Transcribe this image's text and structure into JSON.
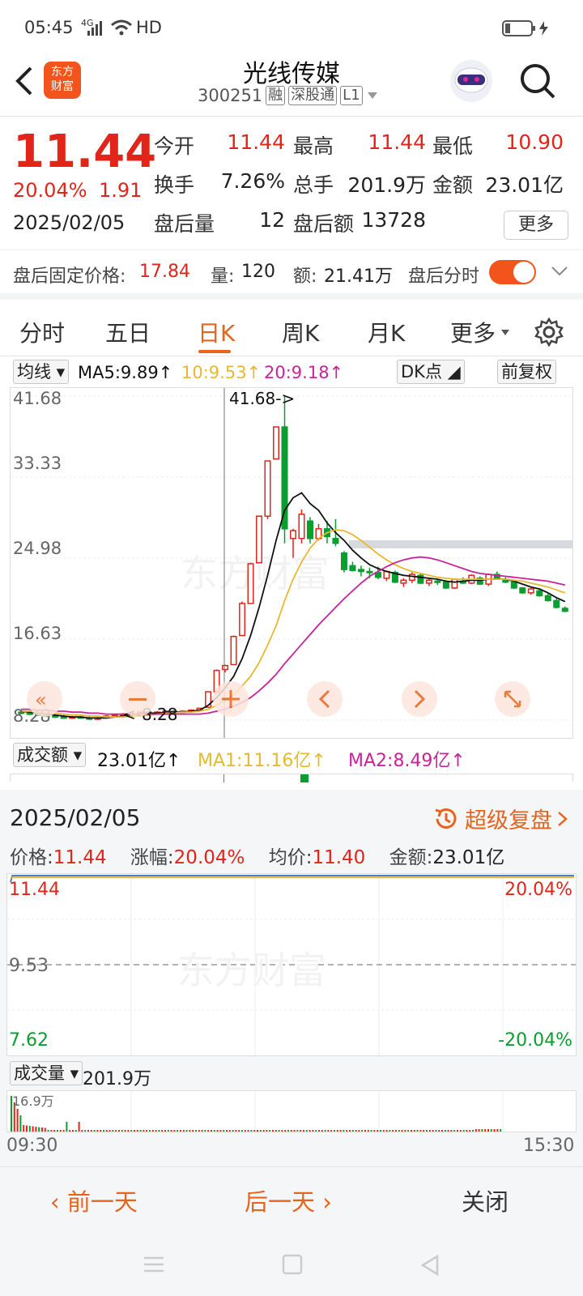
{
  "status": {
    "time": "05:45",
    "network": "4G",
    "hd": "HD"
  },
  "header": {
    "title": "光线传媒",
    "code": "300251",
    "tags": [
      "融",
      "深股通",
      "L1"
    ]
  },
  "quote": {
    "price": "11.44",
    "pct": "20.04%",
    "change": "1.91",
    "date": "2025/02/05",
    "rows": [
      [
        {
          "label": "今开",
          "value": "11.44"
        },
        {
          "label": "最高",
          "value": "11.44"
        },
        {
          "label": "最低",
          "value": "10.90"
        }
      ],
      [
        {
          "label": "换手",
          "value": "7.26%"
        },
        {
          "label": "总手",
          "value": "201.9万"
        },
        {
          "label": "金额",
          "value": "23.01亿"
        }
      ],
      [
        {
          "label": "盘后量",
          "value": "12"
        },
        {
          "label": "盘后额",
          "value": "13728"
        }
      ]
    ],
    "more": "更多"
  },
  "after_hours": {
    "fixed_label": "盘后固定价格:",
    "fixed_price": "17.84",
    "vol_label": "量:",
    "vol": "120",
    "amt_label": "额:",
    "amt": "21.41万",
    "toggle_label": "盘后分时",
    "toggle_on": true
  },
  "tabs": [
    {
      "label": "分时"
    },
    {
      "label": "五日"
    },
    {
      "label": "日K",
      "active": true
    },
    {
      "label": "周K"
    },
    {
      "label": "月K"
    },
    {
      "label": "更多"
    }
  ],
  "ma": {
    "selector": "均线",
    "ma5": "MA5:9.89↑",
    "ma10": "10:9.53↑",
    "ma20": "20:9.18↑",
    "dk": "DK点",
    "adjust": "前复权"
  },
  "colors": {
    "up": "#e1251b",
    "down": "#0a9d2f",
    "accent": "#e8641c",
    "ma5": "#111111",
    "ma10": "#e8b830",
    "ma20": "#cc2299"
  },
  "kline_axis": {
    "y_labels": [
      "41.68",
      "33.33",
      "24.98",
      "16.63",
      "8.28"
    ],
    "max_marker": "41.68->",
    "min_marker": "<-8.28"
  },
  "chart_data": [
    {
      "type": "candlestick",
      "ylim": [
        8.28,
        41.68
      ],
      "series": [
        {
          "open": 9.1,
          "high": 9.3,
          "low": 8.9,
          "close": 9.0
        },
        {
          "open": 9.0,
          "high": 9.2,
          "low": 8.8,
          "close": 8.9
        },
        {
          "open": 8.9,
          "high": 9.1,
          "low": 8.7,
          "close": 8.8
        },
        {
          "open": 8.8,
          "high": 9.0,
          "low": 8.6,
          "close": 8.7
        },
        {
          "open": 8.7,
          "high": 8.9,
          "low": 8.5,
          "close": 8.6
        },
        {
          "open": 8.6,
          "high": 8.8,
          "low": 8.4,
          "close": 8.5
        },
        {
          "open": 8.5,
          "high": 8.7,
          "low": 8.4,
          "close": 8.6
        },
        {
          "open": 8.6,
          "high": 8.8,
          "low": 8.5,
          "close": 8.5
        },
        {
          "open": 8.5,
          "high": 8.7,
          "low": 8.3,
          "close": 8.4
        },
        {
          "open": 8.4,
          "high": 8.6,
          "low": 8.28,
          "close": 8.5
        },
        {
          "open": 8.5,
          "high": 8.8,
          "low": 8.4,
          "close": 8.7
        },
        {
          "open": 8.7,
          "high": 8.9,
          "low": 8.6,
          "close": 8.8
        },
        {
          "open": 8.8,
          "high": 9.0,
          "low": 8.7,
          "close": 8.9
        },
        {
          "open": 8.9,
          "high": 9.1,
          "low": 8.8,
          "close": 9.0
        },
        {
          "open": 9.0,
          "high": 9.2,
          "low": 8.9,
          "close": 9.1
        },
        {
          "open": 9.1,
          "high": 9.3,
          "low": 9.0,
          "close": 9.0
        },
        {
          "open": 9.0,
          "high": 9.2,
          "low": 8.9,
          "close": 9.1
        },
        {
          "open": 9.1,
          "high": 9.3,
          "low": 9.0,
          "close": 9.2
        },
        {
          "open": 9.2,
          "high": 9.3,
          "low": 9.0,
          "close": 9.1
        },
        {
          "open": 9.1,
          "high": 9.3,
          "low": 9.0,
          "close": 9.2
        },
        {
          "open": 9.2,
          "high": 9.4,
          "low": 9.1,
          "close": 9.3
        },
        {
          "open": 9.3,
          "high": 9.5,
          "low": 9.2,
          "close": 9.5
        },
        {
          "open": 9.6,
          "high": 11.2,
          "low": 9.6,
          "close": 11.2
        },
        {
          "open": 11.2,
          "high": 13.5,
          "low": 11.2,
          "close": 13.4
        },
        {
          "open": 13.5,
          "high": 14.0,
          "low": 13.2,
          "close": 13.9
        },
        {
          "open": 14.0,
          "high": 17.0,
          "low": 14.0,
          "close": 16.9
        },
        {
          "open": 17.0,
          "high": 20.5,
          "low": 17.0,
          "close": 20.3
        },
        {
          "open": 20.3,
          "high": 24.5,
          "low": 20.3,
          "close": 24.4
        },
        {
          "open": 24.5,
          "high": 29.3,
          "low": 24.5,
          "close": 29.3
        },
        {
          "open": 29.3,
          "high": 35.0,
          "low": 29.0,
          "close": 35.0
        },
        {
          "open": 35.2,
          "high": 38.5,
          "low": 35.2,
          "close": 38.5
        },
        {
          "open": 38.5,
          "high": 41.68,
          "low": 26.5,
          "close": 28.0
        },
        {
          "open": 27.0,
          "high": 28.0,
          "low": 25.0,
          "close": 27.8
        },
        {
          "open": 27.0,
          "high": 30.0,
          "low": 26.5,
          "close": 29.5
        },
        {
          "open": 28.8,
          "high": 29.2,
          "low": 26.5,
          "close": 27.0
        },
        {
          "open": 27.0,
          "high": 28.5,
          "low": 26.8,
          "close": 28.0
        },
        {
          "open": 28.0,
          "high": 28.8,
          "low": 26.5,
          "close": 27.2
        },
        {
          "open": 27.0,
          "high": 29.0,
          "low": 26.2,
          "close": 26.5
        },
        {
          "open": 25.5,
          "high": 25.7,
          "low": 23.5,
          "close": 23.8
        },
        {
          "open": 24.2,
          "high": 24.6,
          "low": 23.6,
          "close": 23.7
        },
        {
          "open": 23.8,
          "high": 24.2,
          "low": 23.1,
          "close": 23.6
        },
        {
          "open": 23.6,
          "high": 24.0,
          "low": 22.9,
          "close": 23.5
        },
        {
          "open": 23.5,
          "high": 24.1,
          "low": 22.8,
          "close": 23.0
        },
        {
          "open": 22.9,
          "high": 23.7,
          "low": 22.6,
          "close": 23.6
        },
        {
          "open": 23.5,
          "high": 23.7,
          "low": 22.4,
          "close": 22.5
        },
        {
          "open": 22.4,
          "high": 22.9,
          "low": 22.0,
          "close": 22.7
        },
        {
          "open": 22.7,
          "high": 23.5,
          "low": 22.4,
          "close": 23.3
        },
        {
          "open": 23.2,
          "high": 23.4,
          "low": 22.3,
          "close": 22.4
        },
        {
          "open": 22.4,
          "high": 22.9,
          "low": 22.1,
          "close": 22.7
        },
        {
          "open": 22.6,
          "high": 22.8,
          "low": 22.2,
          "close": 22.5
        },
        {
          "open": 22.5,
          "high": 22.7,
          "low": 21.8,
          "close": 21.9
        },
        {
          "open": 21.9,
          "high": 22.9,
          "low": 21.8,
          "close": 22.8
        },
        {
          "open": 22.6,
          "high": 23.0,
          "low": 22.3,
          "close": 22.4
        },
        {
          "open": 22.4,
          "high": 23.3,
          "low": 22.3,
          "close": 23.2
        },
        {
          "open": 22.9,
          "high": 23.1,
          "low": 22.2,
          "close": 22.3
        },
        {
          "open": 22.3,
          "high": 23.4,
          "low": 22.1,
          "close": 23.3
        },
        {
          "open": 23.3,
          "high": 23.6,
          "low": 22.8,
          "close": 22.9
        },
        {
          "open": 22.8,
          "high": 23.0,
          "low": 22.4,
          "close": 22.5
        },
        {
          "open": 22.5,
          "high": 22.6,
          "low": 21.8,
          "close": 21.9
        },
        {
          "open": 21.9,
          "high": 22.0,
          "low": 21.3,
          "close": 21.4
        },
        {
          "open": 21.4,
          "high": 21.9,
          "low": 21.2,
          "close": 21.8
        },
        {
          "open": 21.6,
          "high": 21.8,
          "low": 21.0,
          "close": 21.1
        },
        {
          "open": 21.1,
          "high": 21.3,
          "low": 20.5,
          "close": 20.6
        },
        {
          "open": 20.6,
          "high": 20.8,
          "low": 19.8,
          "close": 19.9
        },
        {
          "open": 19.8,
          "high": 20.0,
          "low": 19.4,
          "close": 19.5
        }
      ],
      "lines": [
        {
          "name": "MA5",
          "values": [
            9.2,
            9.1,
            9.0,
            8.9,
            8.8,
            8.7,
            8.6,
            8.6,
            8.5,
            8.5,
            8.5,
            8.6,
            8.7,
            8.8,
            8.9,
            9.0,
            9.0,
            9.1,
            9.1,
            9.1,
            9.2,
            9.3,
            9.8,
            10.6,
            11.6,
            12.8,
            14.6,
            17.0,
            19.9,
            23.2,
            26.8,
            29.9,
            31.2,
            31.7,
            30.6,
            29.9,
            28.6,
            27.6,
            26.8,
            25.8,
            25.0,
            24.3,
            23.9,
            23.6,
            23.4,
            23.2,
            23.1,
            23.0,
            22.9,
            22.8,
            22.6,
            22.5,
            22.6,
            22.7,
            22.7,
            22.8,
            22.8,
            22.8,
            22.6,
            22.3,
            22.0,
            21.8,
            21.4,
            20.9,
            20.5
          ]
        },
        {
          "name": "10",
          "values": [
            9.2,
            9.2,
            9.1,
            9.0,
            9.0,
            8.9,
            8.8,
            8.8,
            8.7,
            8.7,
            8.6,
            8.6,
            8.6,
            8.7,
            8.7,
            8.8,
            8.9,
            9.0,
            9.0,
            9.1,
            9.1,
            9.2,
            9.4,
            9.8,
            10.3,
            10.9,
            11.8,
            12.8,
            14.2,
            16.0,
            18.0,
            20.6,
            22.8,
            24.6,
            26.0,
            27.0,
            27.6,
            27.9,
            27.8,
            27.4,
            26.8,
            26.1,
            25.4,
            24.8,
            24.3,
            23.9,
            23.6,
            23.4,
            23.2,
            23.0,
            22.9,
            22.8,
            22.8,
            22.8,
            22.8,
            22.8,
            22.8,
            22.8,
            22.7,
            22.6,
            22.4,
            22.2,
            22.0,
            21.7,
            21.4
          ]
        },
        {
          "name": "20",
          "values": [
            9.4,
            9.4,
            9.3,
            9.3,
            9.2,
            9.2,
            9.1,
            9.1,
            9.0,
            9.0,
            8.9,
            8.9,
            8.9,
            8.9,
            8.9,
            8.9,
            8.9,
            8.9,
            8.9,
            8.9,
            8.9,
            8.9,
            9.0,
            9.2,
            9.4,
            9.7,
            10.1,
            10.6,
            11.3,
            12.1,
            13.0,
            14.1,
            15.1,
            16.1,
            17.1,
            18.1,
            19.0,
            19.9,
            20.8,
            21.6,
            22.4,
            23.1,
            23.6,
            24.1,
            24.5,
            24.8,
            25.0,
            25.1,
            25.0,
            24.8,
            24.5,
            24.2,
            23.9,
            23.6,
            23.4,
            23.3,
            23.2,
            23.1,
            23.0,
            22.9,
            22.8,
            22.7,
            22.6,
            22.4,
            22.2
          ]
        }
      ],
      "ylabel": "",
      "xlabel": ""
    },
    {
      "type": "line",
      "title": "",
      "ylim": [
        7.62,
        11.44
      ],
      "series": [
        {
          "name": "",
          "values": [
            11.3,
            11.44,
            11.44,
            11.44,
            11.44,
            11.44,
            11.44,
            11.44
          ]
        }
      ]
    }
  ],
  "volume": {
    "selector": "成交额",
    "value": "23.01亿↑",
    "ma1": "MA1:11.16亿↑",
    "ma2": "MA2:8.49亿↑"
  },
  "detail": {
    "date": "2025/02/05",
    "super": "超级复盘",
    "price_label": "价格:",
    "price": "11.44",
    "pct_label": "涨幅:",
    "pct": "20.04%",
    "avg_label": "均价:",
    "avg": "11.40",
    "amt_label": "金额:",
    "amt": "23.01亿",
    "ytop": "11.44",
    "ymid": "9.53",
    "ybot": "7.62",
    "pct_top": "20.04%",
    "pct_bot": "-20.04%",
    "vol_selector": "成交量",
    "vol_value": "201.9万",
    "vol_peak": "16.9万",
    "t_start": "09:30",
    "t_end": "15:30"
  },
  "nav": {
    "prev": "前一天",
    "next": "后一天",
    "close": "关闭"
  }
}
